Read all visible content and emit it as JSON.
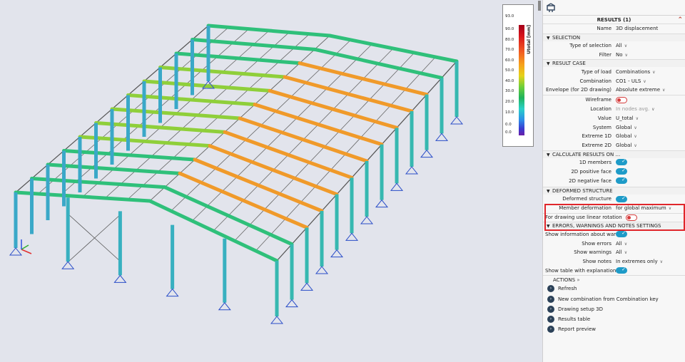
{
  "legend": {
    "unit": "Utotal [mm]",
    "values": [
      "93.0",
      "90.0",
      "80.0",
      "70.0",
      "60.0",
      "50.0",
      "40.0",
      "30.0",
      "20.0",
      "10.0",
      "0.0",
      "0.0"
    ]
  },
  "panel": {
    "title": "RESULTS (1)",
    "name_label": "Name",
    "name_value": "3D displacement",
    "selection": {
      "header": "SELECTION",
      "type_label": "Type of selection",
      "type_value": "All",
      "filter_label": "Filter",
      "filter_value": "No"
    },
    "result_case": {
      "header": "RESULT CASE",
      "load_label": "Type of load",
      "load_value": "Combinations",
      "comb_label": "Combination",
      "comb_value": "CO1 - ULS",
      "env_label": "Envelope (for 2D drawing)",
      "env_value": "Absolute extreme"
    },
    "display": {
      "wireframe_label": "Wireframe",
      "location_label": "Location",
      "location_value": "In nodes avg.",
      "value_label": "Value",
      "value_value": "U_total",
      "system_label": "System",
      "system_value": "Global",
      "ext1d_label": "Extreme 1D",
      "ext1d_value": "Global",
      "ext2d_label": "Extreme 2D",
      "ext2d_value": "Global"
    },
    "calculate": {
      "header": "CALCULATE RESULTS ON ...",
      "m1d_label": "1D members",
      "pos_label": "2D positive face",
      "neg_label": "2D negative face"
    },
    "deformed": {
      "header": "DEFORMED STRUCTURE",
      "struct_label": "Deformed structure",
      "member_label": "Member deformation",
      "member_value": "for global maximum"
    },
    "linear_rot_label": "For drawing use linear rotation",
    "errors": {
      "header": "ERRORS, WARNINGS AND NOTES SETTINGS",
      "info_label": "Show information about war...",
      "errors_label": "Show errors",
      "errors_value": "All",
      "warnings_label": "Show warnings",
      "warnings_value": "All",
      "notes_label": "Show notes",
      "notes_value": "In extremes only",
      "table_label": "Show table with explanation ..."
    },
    "actions": {
      "header": "ACTIONS",
      "items": [
        "Refresh",
        "New combination from Combination key",
        "Drawing setup 3D",
        "Results table",
        "Report preview"
      ]
    }
  }
}
